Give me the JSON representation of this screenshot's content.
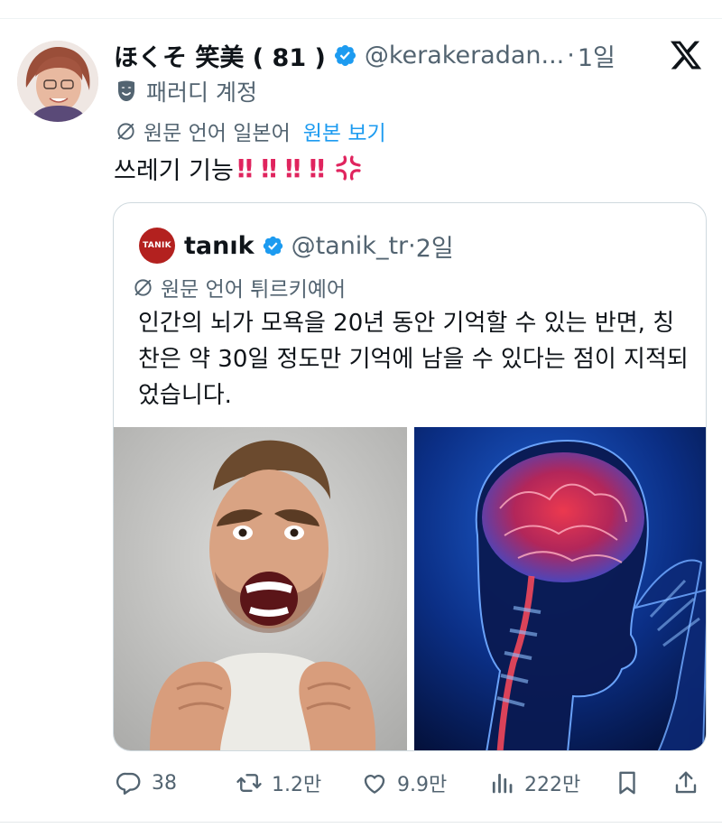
{
  "tweet": {
    "author": {
      "display_name": "ほくそ 笑美 ( 81 )",
      "handle": "@kerakeradan...",
      "time": "1일",
      "label": "패러디 계정"
    },
    "translation": {
      "note": "원문 언어 일본어",
      "show_original": "원본 보기"
    },
    "text": "쓰레기 기능",
    "emphasis_marks": [
      "‼",
      "‼",
      "‼",
      "‼"
    ],
    "trailing_icon": "anger-symbol-icon"
  },
  "quote": {
    "avatar_text": "TANIK",
    "display_name": "tanık",
    "handle": "@tanik_tr",
    "time": "2일",
    "translation_note": "원문 언어 튀르키예어",
    "text": "인간의 뇌가 모욕을 20년 동안 기억할 수 있는 반면, 칭찬은 약 30일 정도만 기억에 남을 수 있다는 점이 지적되었습니다.",
    "images": [
      "angry-man-photo",
      "brain-xray-photo"
    ]
  },
  "actions": {
    "replies": "38",
    "reposts": "1.2만",
    "likes": "9.9만",
    "views": "222만"
  },
  "colors": {
    "accent": "#1d9bf0",
    "verified": "#1d9bf0",
    "text": "#0f1419",
    "secondary": "#536471",
    "emphasis": "#e0245e",
    "quote_avatar": "#b3211f"
  },
  "icons": [
    "x-logo-icon",
    "verified-badge-icon",
    "theater-mask-icon",
    "translate-globe-icon",
    "reply-icon",
    "repost-icon",
    "like-icon",
    "views-icon",
    "bookmark-icon",
    "share-icon"
  ]
}
